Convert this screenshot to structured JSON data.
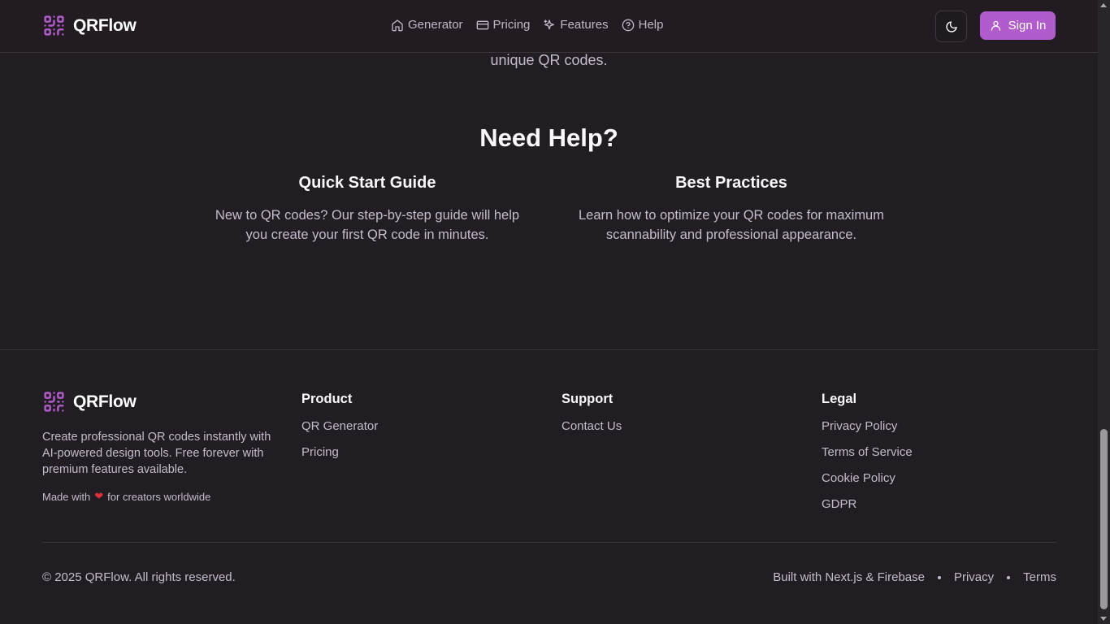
{
  "header": {
    "brand": "QRFlow",
    "nav": [
      {
        "label": "Generator",
        "icon": "home-icon"
      },
      {
        "label": "Pricing",
        "icon": "credit-card-icon"
      },
      {
        "label": "Features",
        "icon": "sparkles-icon"
      },
      {
        "label": "Help",
        "icon": "help-circle-icon"
      }
    ],
    "theme_toggle_icon": "moon-icon",
    "signin_label": "Sign In"
  },
  "colors": {
    "background": "#221d22",
    "accent": "#b15ccc",
    "muted_text": "#c4bccb",
    "heart": "#e0303b"
  },
  "partial_text": "unique QR codes.",
  "help": {
    "title": "Need Help?",
    "cards": [
      {
        "title": "Quick Start Guide",
        "text": "New to QR codes? Our step-by-step guide will help you create your first QR code in minutes."
      },
      {
        "title": "Best Practices",
        "text": "Learn how to optimize your QR codes for maximum scannability and professional appearance."
      }
    ]
  },
  "footer": {
    "brand": "QRFlow",
    "description": "Create professional QR codes instantly with AI-powered design tools. Free forever with premium features available.",
    "made_with_prefix": "Made with",
    "made_with_suffix": "for creators worldwide",
    "columns": {
      "product": {
        "title": "Product",
        "links": [
          "QR Generator",
          "Pricing"
        ]
      },
      "support": {
        "title": "Support",
        "links": [
          "Contact Us"
        ]
      },
      "legal": {
        "title": "Legal",
        "links": [
          "Privacy Policy",
          "Terms of Service",
          "Cookie Policy",
          "GDPR"
        ]
      }
    },
    "copyright": "© 2025 QRFlow. All rights reserved.",
    "bottom_links": [
      "Built with Next.js & Firebase",
      "Privacy",
      "Terms"
    ]
  }
}
